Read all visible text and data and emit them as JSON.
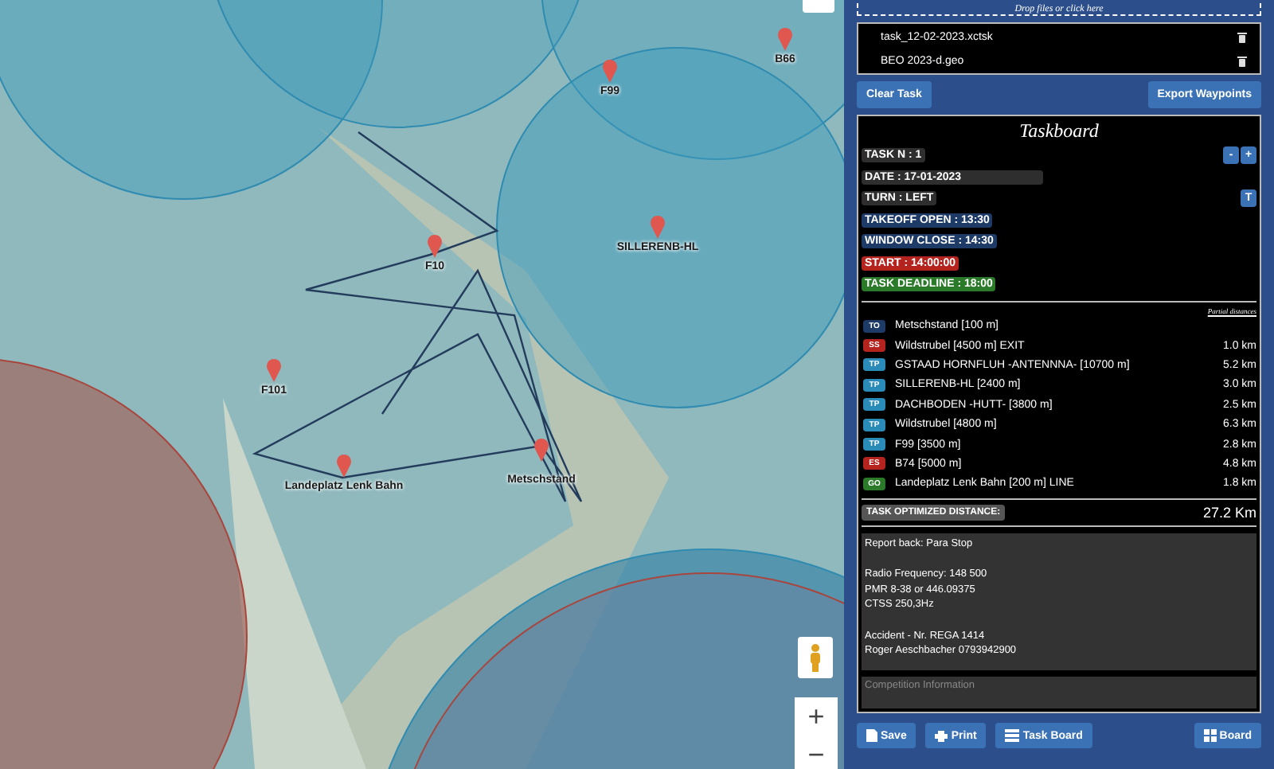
{
  "map": {
    "markers": [
      {
        "label": "F99",
        "kind": "pin"
      },
      {
        "label": "B66",
        "kind": "pin"
      },
      {
        "label": "F10",
        "kind": "pin"
      },
      {
        "label": "SILLERENB-HL",
        "kind": "pin"
      },
      {
        "label": "F101",
        "kind": "pin"
      },
      {
        "label": "Landeplatz Lenk Bahn",
        "kind": "pin"
      },
      {
        "label": "Metschstand",
        "kind": "pin"
      }
    ],
    "zoom_in": "+",
    "zoom_out": "−"
  },
  "panel": {
    "dropzone": "Drop files or click here",
    "files": [
      {
        "name": "task_12-02-2023.xctsk"
      },
      {
        "name": "BEO 2023-d.geo"
      }
    ],
    "clear_button": "Clear Task",
    "export_button": "Export Waypoints",
    "taskboard": {
      "title": "Taskboard",
      "info": [
        {
          "text": "TASK N : 1",
          "color": "#2e2e2e",
          "kind": "stepper"
        },
        {
          "text": "DATE :  17-01-2023",
          "color": "#2e2e2e",
          "kind": "date"
        },
        {
          "text": "TURN : LEFT",
          "color": "#2e2e2e",
          "kind": "toggle"
        },
        {
          "text": "TAKEOFF OPEN : 13:30",
          "color": "#1e3a66",
          "kind": "plain"
        },
        {
          "text": "WINDOW CLOSE : 14:30",
          "color": "#1e3a66",
          "kind": "plain"
        },
        {
          "text": "START : 14:00:00",
          "color": "#b5231f",
          "kind": "plain"
        },
        {
          "text": "TASK DEADLINE : 18:00",
          "color": "#2a7a2a",
          "kind": "plain"
        }
      ],
      "minus": "-",
      "plus": "+",
      "toggle": "T",
      "partial_label": "Partial distances",
      "waypoints": [
        {
          "type": "TO",
          "color": "#1e3a66",
          "name": "Metschstand [100 m]"
        },
        {
          "type": "SS",
          "color": "#b5231f",
          "name": "Wildstrubel [4500 m] EXIT",
          "distance": "1.0 km"
        },
        {
          "type": "TP",
          "color": "#2a8ab8",
          "name": "GSTAAD HORNFLUH -ANTENNNA- [10700 m]",
          "distance": "5.2 km"
        },
        {
          "type": "TP",
          "color": "#2a8ab8",
          "name": "SILLERENB-HL [2400 m]",
          "distance": "3.0 km"
        },
        {
          "type": "TP",
          "color": "#2a8ab8",
          "name": "DACHBODEN -HUTT- [3800 m]",
          "distance": "2.5 km"
        },
        {
          "type": "TP",
          "color": "#2a8ab8",
          "name": "Wildstrubel [4800 m]",
          "distance": "6.3 km"
        },
        {
          "type": "TP",
          "color": "#2a8ab8",
          "name": "F99 [3500 m]",
          "distance": "2.8 km"
        },
        {
          "type": "ES",
          "color": "#b5231f",
          "name": "B74 [5000 m]",
          "distance": "4.8 km"
        },
        {
          "type": "GO",
          "color": "#2a7a2a",
          "name": "Landeplatz Lenk Bahn [200 m] LINE",
          "distance": "1.8 km"
        }
      ],
      "optimized_label": "TASK OPTIMIZED DISTANCE:",
      "optimized_value": "27.2 Km",
      "notes": [
        [
          "Report back: Para Stop"
        ],
        [
          "Radio Frequency: 148 500",
          "PMR 8-38 or 446.09375",
          "CTSS 250,3Hz"
        ],
        [
          "Accident - Nr. REGA 1414",
          "Roger Aeschbacher 0793942900"
        ]
      ],
      "competition": {
        "placeholder": "Competition Information"
      }
    },
    "buttons": [
      {
        "label": "Save"
      },
      {
        "label": "Print"
      },
      {
        "label": "Task Board"
      },
      {
        "label": "Board"
      }
    ]
  }
}
